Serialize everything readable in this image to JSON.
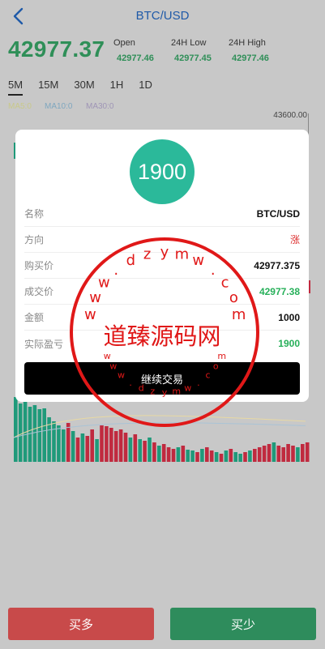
{
  "header": {
    "title": "BTC/USD"
  },
  "ticker": {
    "last_price": "42977.37",
    "open_label": "Open",
    "open_value": "42977.46",
    "low_label": "24H Low",
    "low_value": "42977.45",
    "high_label": "24H High",
    "high_value": "42977.46"
  },
  "periods": [
    "5M",
    "15M",
    "30M",
    "1H",
    "1D"
  ],
  "ma": {
    "ma5": "MA5:0",
    "ma10": "MA10:0",
    "ma30": "MA30:0"
  },
  "axis": {
    "top_value": "43600.00"
  },
  "modal": {
    "pnl_circle": "1900",
    "rows": [
      {
        "label": "名称",
        "value": "BTC/USD"
      },
      {
        "label": "方向",
        "value": "涨"
      },
      {
        "label": "购买价",
        "value": "42977.375"
      },
      {
        "label": "成交价",
        "value": "42977.38"
      },
      {
        "label": "金额",
        "value": "1000"
      },
      {
        "label": "实际盈亏",
        "value": "1900"
      }
    ],
    "continue_label": "继续交易"
  },
  "watermark": {
    "main_text": "道臻源码网",
    "top_letters": [
      "w",
      "w",
      "w",
      ".",
      "d",
      "z",
      "y",
      "m",
      "w",
      ".",
      "c",
      "o",
      "m"
    ],
    "bottom_letters": [
      "w",
      "w",
      "w",
      ".",
      "d",
      "z",
      "y",
      "m",
      "w",
      ".",
      "c",
      "o",
      "m"
    ],
    "color": "#e01818"
  },
  "footer": {
    "buy_label": "买多",
    "sell_label": "买少"
  },
  "colors": {
    "up": "#c02a3f",
    "down": "#1f9a7a",
    "accent": "#2f8f58",
    "title": "#1f5aa8"
  }
}
